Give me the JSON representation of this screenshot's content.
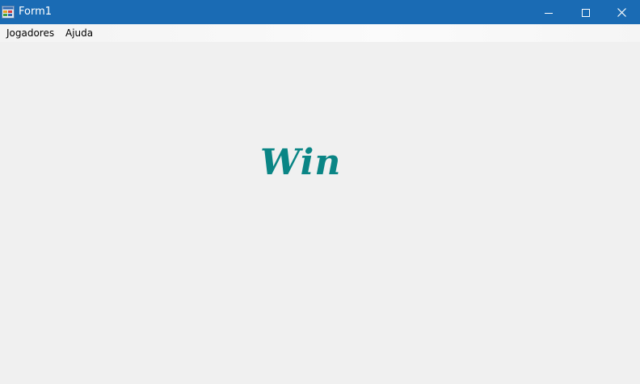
{
  "window": {
    "title": "Form1",
    "titlebar_color": "#1a6bb4",
    "background_color": "#f0f0f0",
    "icon": "form-app-icon",
    "controls": {
      "minimize_icon": "minimize-icon",
      "maximize_icon": "maximize-icon",
      "close_icon": "close-icon"
    }
  },
  "menu": {
    "items": [
      {
        "label": "Jogadores"
      },
      {
        "label": "Ajuda"
      }
    ]
  },
  "main": {
    "result_label": "Win",
    "result_color": "#0a8585"
  }
}
